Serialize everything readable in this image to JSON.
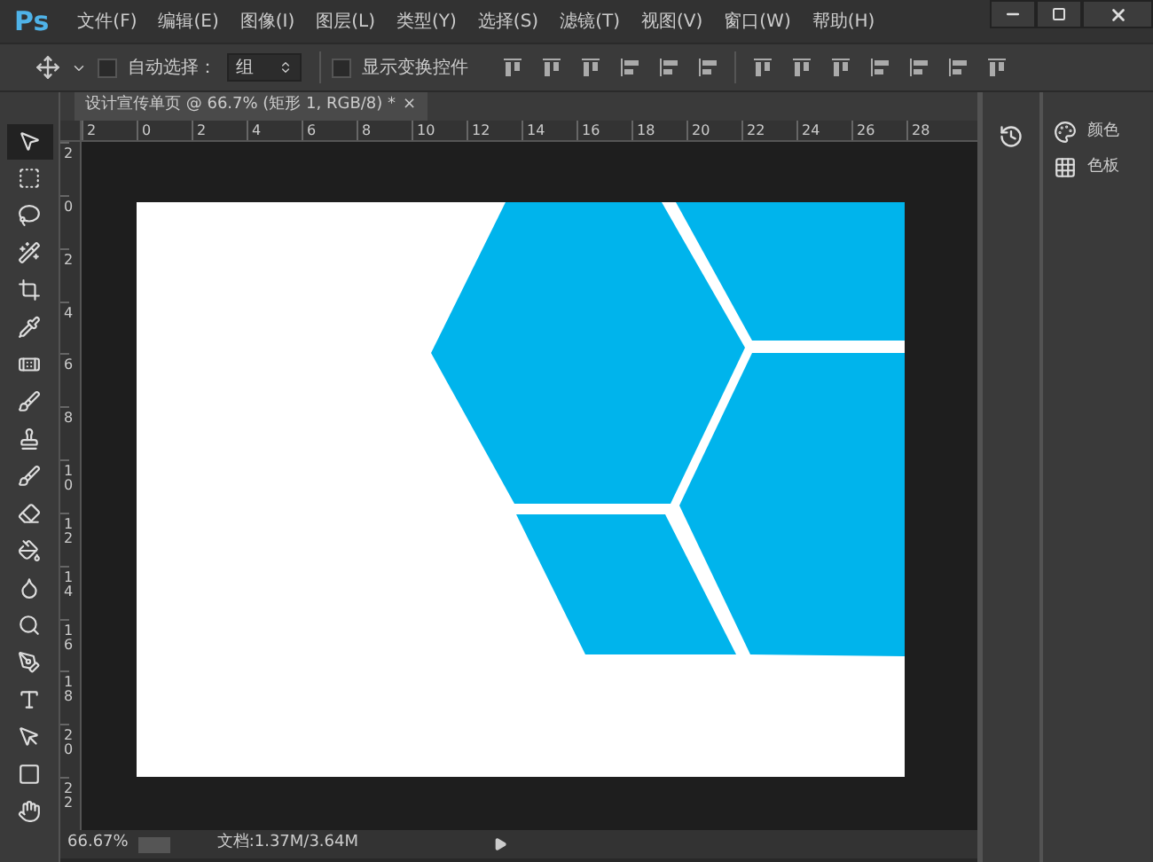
{
  "app_logo": "Ps",
  "menu": [
    "文件(F)",
    "编辑(E)",
    "图像(I)",
    "图层(L)",
    "类型(Y)",
    "选择(S)",
    "滤镜(T)",
    "视图(V)",
    "窗口(W)",
    "帮助(H)"
  ],
  "options_bar": {
    "auto_select": {
      "label": "自动选择：",
      "checked": false
    },
    "auto_select_target": "组",
    "show_transform": {
      "label": "显示变换控件",
      "checked": false
    }
  },
  "document_tab": {
    "title": "设计宣传单页 @ 66.7% (矩形 1, RGB/8) *",
    "close": "×",
    "selected": true
  },
  "top_ruler": [
    "2",
    "0",
    "2",
    "4",
    "6",
    "8",
    "10",
    "12",
    "14",
    "16",
    "18",
    "20",
    "22",
    "24",
    "26",
    "28"
  ],
  "left_ruler": [
    "2",
    "0",
    "2",
    "4",
    "6",
    "8",
    "10",
    "12",
    "14",
    "16",
    "18",
    "20",
    "22"
  ],
  "tools": [
    {
      "selected": true
    },
    {
      "selected": false
    },
    {
      "selected": false
    },
    {
      "selected": false
    },
    {
      "selected": false
    },
    {
      "selected": false
    },
    {
      "selected": false
    },
    {
      "selected": false
    },
    {
      "selected": false
    },
    {
      "selected": false
    },
    {
      "selected": false
    },
    {
      "selected": false
    },
    {
      "selected": false
    },
    {
      "selected": false
    },
    {
      "selected": false
    },
    {
      "selected": false
    },
    {
      "selected": false
    },
    {
      "selected": false
    },
    {
      "selected": false
    }
  ],
  "status_bar": {
    "zoom": "66.67%",
    "document_size": "文档:1.37M/3.64M"
  },
  "panels": [
    {
      "label": "颜色"
    },
    {
      "label": "色板"
    }
  ]
}
